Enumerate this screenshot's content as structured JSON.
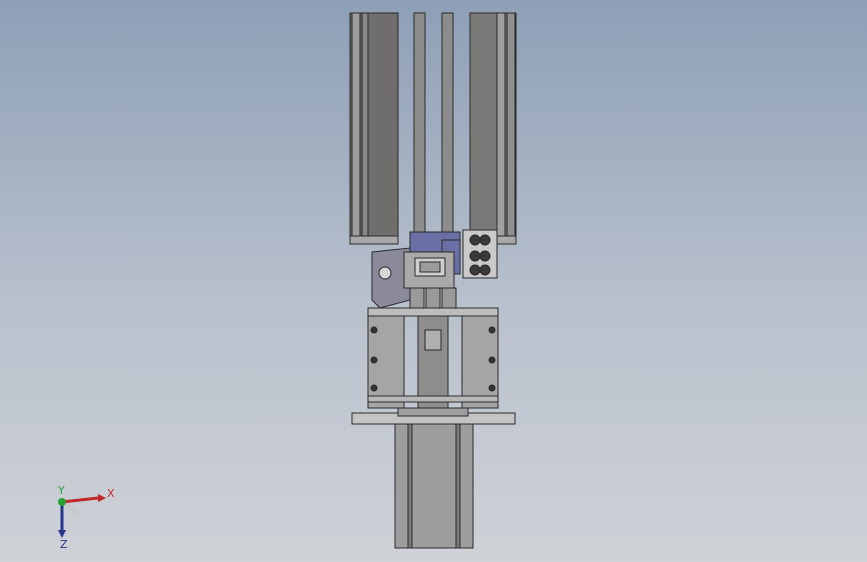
{
  "viewport": {
    "background_top": "#8e9fb6",
    "background_bottom": "#cfd2d7"
  },
  "model": {
    "colors": {
      "steel_dark": "#6e6e6e",
      "steel_mid": "#9a9a9a",
      "steel_light": "#b8b8b8",
      "edge": "#2a2a2a",
      "accent_blue": "#6a6fa6"
    }
  },
  "triad": {
    "x_label": "X",
    "y_label": "Y",
    "z_label": "Z",
    "x_color": "#c0282d",
    "y_color": "#2aa137",
    "z_color": "#27368c"
  }
}
